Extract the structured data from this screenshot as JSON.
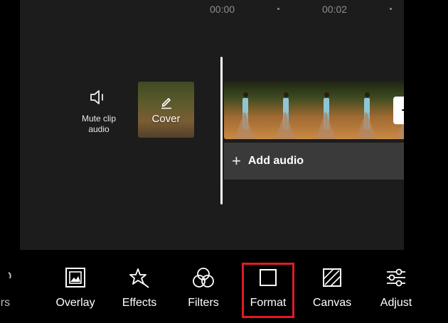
{
  "timeline": {
    "ruler": {
      "timecodes": [
        "00:00",
        "00:02"
      ]
    },
    "mute_clip": {
      "label_line1": "Mute clip",
      "label_line2": "audio"
    },
    "cover": {
      "label": "Cover"
    },
    "add_clip_symbol": "+",
    "add_audio": {
      "symbol": "+",
      "label": "Add audio"
    }
  },
  "toolbar": {
    "partial_label": "ers",
    "items": [
      {
        "label": "Overlay",
        "icon": "overlay-icon"
      },
      {
        "label": "Effects",
        "icon": "effects-icon"
      },
      {
        "label": "Filters",
        "icon": "filters-icon"
      },
      {
        "label": "Format",
        "icon": "format-icon"
      },
      {
        "label": "Canvas",
        "icon": "canvas-icon"
      },
      {
        "label": "Adjust",
        "icon": "adjust-icon"
      }
    ],
    "highlight_color": "#e01b24"
  },
  "colors": {
    "background": "#000000",
    "editor_panel": "#1c1c1c",
    "add_audio_bar": "#3a3a3a"
  }
}
